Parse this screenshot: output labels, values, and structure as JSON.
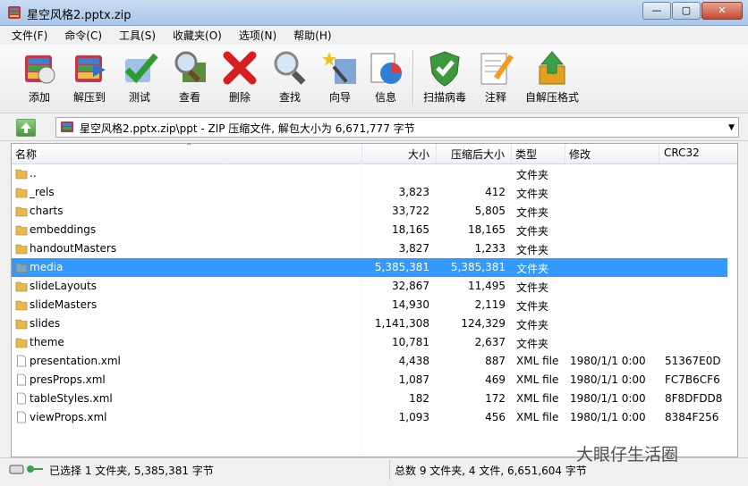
{
  "window": {
    "title": "星空风格2.pptx.zip"
  },
  "titlebar_buttons": [
    "—",
    "▢",
    "✕"
  ],
  "menu": [
    "文件(F)",
    "命令(C)",
    "工具(S)",
    "收藏夹(O)",
    "选项(N)",
    "帮助(H)"
  ],
  "toolbar": [
    {
      "label": "添加",
      "icon": "add-icon"
    },
    {
      "label": "解压到",
      "icon": "extract-icon"
    },
    {
      "label": "测试",
      "icon": "test-icon"
    },
    {
      "label": "查看",
      "icon": "view-icon"
    },
    {
      "label": "删除",
      "icon": "delete-icon"
    },
    {
      "label": "查找",
      "icon": "find-icon"
    },
    {
      "label": "向导",
      "icon": "wizard-icon"
    },
    {
      "label": "信息",
      "icon": "info-icon"
    },
    {
      "label": "扫描病毒",
      "icon": "virus-scan-icon"
    },
    {
      "label": "注释",
      "icon": "comment-icon"
    },
    {
      "label": "自解压格式",
      "icon": "sfx-icon"
    }
  ],
  "address": "星空风格2.pptx.zip\\ppt - ZIP 压缩文件, 解包大小为 6,671,777 字节",
  "columns": [
    "名称",
    "大小",
    "压缩后大小",
    "类型",
    "修改",
    "CRC32"
  ],
  "files": [
    {
      "name": "..",
      "size": "",
      "packed": "",
      "type": "文件夹",
      "modified": "",
      "crc": "",
      "kind": "folder"
    },
    {
      "name": "_rels",
      "size": "3,823",
      "packed": "412",
      "type": "文件夹",
      "modified": "",
      "crc": "",
      "kind": "folder"
    },
    {
      "name": "charts",
      "size": "33,722",
      "packed": "5,805",
      "type": "文件夹",
      "modified": "",
      "crc": "",
      "kind": "folder"
    },
    {
      "name": "embeddings",
      "size": "18,165",
      "packed": "18,165",
      "type": "文件夹",
      "modified": "",
      "crc": "",
      "kind": "folder"
    },
    {
      "name": "handoutMasters",
      "size": "3,827",
      "packed": "1,233",
      "type": "文件夹",
      "modified": "",
      "crc": "",
      "kind": "folder"
    },
    {
      "name": "media",
      "size": "5,385,381",
      "packed": "5,385,381",
      "type": "文件夹",
      "modified": "",
      "crc": "",
      "kind": "folder",
      "selected": true
    },
    {
      "name": "slideLayouts",
      "size": "32,867",
      "packed": "11,495",
      "type": "文件夹",
      "modified": "",
      "crc": "",
      "kind": "folder"
    },
    {
      "name": "slideMasters",
      "size": "14,930",
      "packed": "2,119",
      "type": "文件夹",
      "modified": "",
      "crc": "",
      "kind": "folder"
    },
    {
      "name": "slides",
      "size": "1,141,308",
      "packed": "124,329",
      "type": "文件夹",
      "modified": "",
      "crc": "",
      "kind": "folder"
    },
    {
      "name": "theme",
      "size": "10,781",
      "packed": "2,637",
      "type": "文件夹",
      "modified": "",
      "crc": "",
      "kind": "folder"
    },
    {
      "name": "presentation.xml",
      "size": "4,438",
      "packed": "887",
      "type": "XML file",
      "modified": "1980/1/1 0:00",
      "crc": "51367E0D",
      "kind": "file"
    },
    {
      "name": "presProps.xml",
      "size": "1,087",
      "packed": "469",
      "type": "XML file",
      "modified": "1980/1/1 0:00",
      "crc": "FC7B6CF6",
      "kind": "file"
    },
    {
      "name": "tableStyles.xml",
      "size": "182",
      "packed": "172",
      "type": "XML file",
      "modified": "1980/1/1 0:00",
      "crc": "8F8DFDD8",
      "kind": "file"
    },
    {
      "name": "viewProps.xml",
      "size": "1,093",
      "packed": "456",
      "type": "XML file",
      "modified": "1980/1/1 0:00",
      "crc": "8384F256",
      "kind": "file"
    }
  ],
  "status": {
    "left": "已选择 1 文件夹, 5,385,381 字节",
    "right": "总数 9 文件夹, 4 文件, 6,651,604 字节"
  },
  "watermark": "大眼仔生活圈"
}
